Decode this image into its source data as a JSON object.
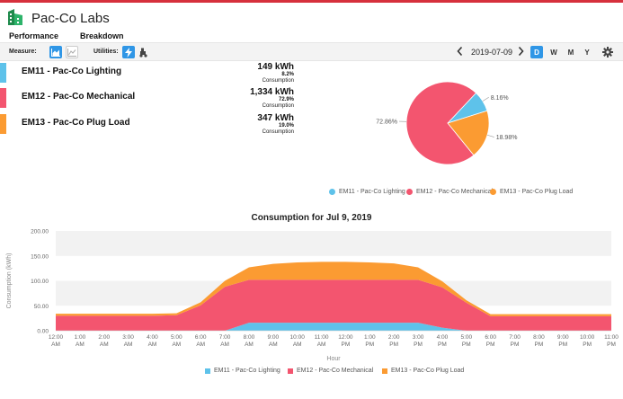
{
  "app": {
    "title": "Pac-Co Labs"
  },
  "tabs": [
    {
      "label": "Performance"
    },
    {
      "label": "Breakdown"
    }
  ],
  "toolbar": {
    "measure_label": "Measure:",
    "utilities_label": "Utilities:",
    "date": "2019-07-09",
    "periods": [
      "D",
      "W",
      "M",
      "Y"
    ],
    "active_period": "D"
  },
  "colors": {
    "lighting": "#5ec2ea",
    "mechanical": "#f3556f",
    "plug": "#fb9b32",
    "accent": "#2f96e6",
    "brand": "#d6303c"
  },
  "meters": [
    {
      "name": "EM11 - Pac-Co Lighting",
      "kwh": "149 kWh",
      "pct": "8.2%",
      "label": "Consumption"
    },
    {
      "name": "EM12 - Pac-Co Mechanical",
      "kwh": "1,334 kWh",
      "pct": "72.9%",
      "label": "Consumption"
    },
    {
      "name": "EM13 - Pac-Co Plug Load",
      "kwh": "347 kWh",
      "pct": "19.0%",
      "label": "Consumption"
    }
  ],
  "pie": {
    "slices": [
      {
        "name": "EM11 - Pac-Co Lighting",
        "value": 8.16,
        "label": "8.16%"
      },
      {
        "name": "EM12 - Pac-Co Mechanical",
        "value": 72.86,
        "label": "72.86%"
      },
      {
        "name": "EM13 - Pac-Co Plug Load",
        "value": 18.98,
        "label": "18.98%"
      }
    ]
  },
  "chart_data": {
    "type": "area",
    "title": "Consumption for Jul 9, 2019",
    "xlabel": "Hour",
    "ylabel": "Consumption (kWh)",
    "ylim": [
      0,
      200
    ],
    "yticks": [
      "0.00",
      "50.00",
      "100.00",
      "150.00",
      "200.00"
    ],
    "yticks_values": [
      0,
      50,
      100,
      150,
      200
    ],
    "categories": [
      [
        "12:00",
        "AM"
      ],
      [
        "1:00",
        "AM"
      ],
      [
        "2:00",
        "AM"
      ],
      [
        "3:00",
        "AM"
      ],
      [
        "4:00",
        "AM"
      ],
      [
        "5:00",
        "AM"
      ],
      [
        "6:00",
        "AM"
      ],
      [
        "7:00",
        "AM"
      ],
      [
        "8:00",
        "AM"
      ],
      [
        "9:00",
        "AM"
      ],
      [
        "10:00",
        "AM"
      ],
      [
        "11:00",
        "AM"
      ],
      [
        "12:00",
        "PM"
      ],
      [
        "1:00",
        "PM"
      ],
      [
        "2:00",
        "PM"
      ],
      [
        "3:00",
        "PM"
      ],
      [
        "4:00",
        "PM"
      ],
      [
        "5:00",
        "PM"
      ],
      [
        "6:00",
        "PM"
      ],
      [
        "7:00",
        "PM"
      ],
      [
        "8:00",
        "PM"
      ],
      [
        "9:00",
        "PM"
      ],
      [
        "10:00",
        "PM"
      ],
      [
        "11:00",
        "PM"
      ]
    ],
    "stacked": true,
    "series": [
      {
        "name": "EM11 - Pac-Co Lighting",
        "values": [
          0,
          0,
          0,
          0,
          0,
          0,
          0,
          0,
          16,
          16,
          16,
          16,
          16,
          16,
          16,
          16,
          6,
          0,
          0,
          0,
          0,
          0,
          0,
          0
        ]
      },
      {
        "name": "EM12 - Pac-Co Mechanical",
        "values": [
          30,
          30,
          30,
          30,
          30,
          31,
          51,
          88,
          86,
          86,
          86,
          86,
          86,
          86,
          86,
          86,
          81,
          56,
          29,
          29,
          29,
          29,
          29,
          29
        ]
      },
      {
        "name": "EM13 - Pac-Co Plug Load",
        "values": [
          4,
          4,
          4,
          4,
          4,
          4,
          6,
          12,
          25,
          32,
          35,
          36,
          36,
          35,
          33,
          25,
          12,
          5,
          4,
          4,
          4,
          4,
          4,
          4
        ]
      }
    ]
  }
}
